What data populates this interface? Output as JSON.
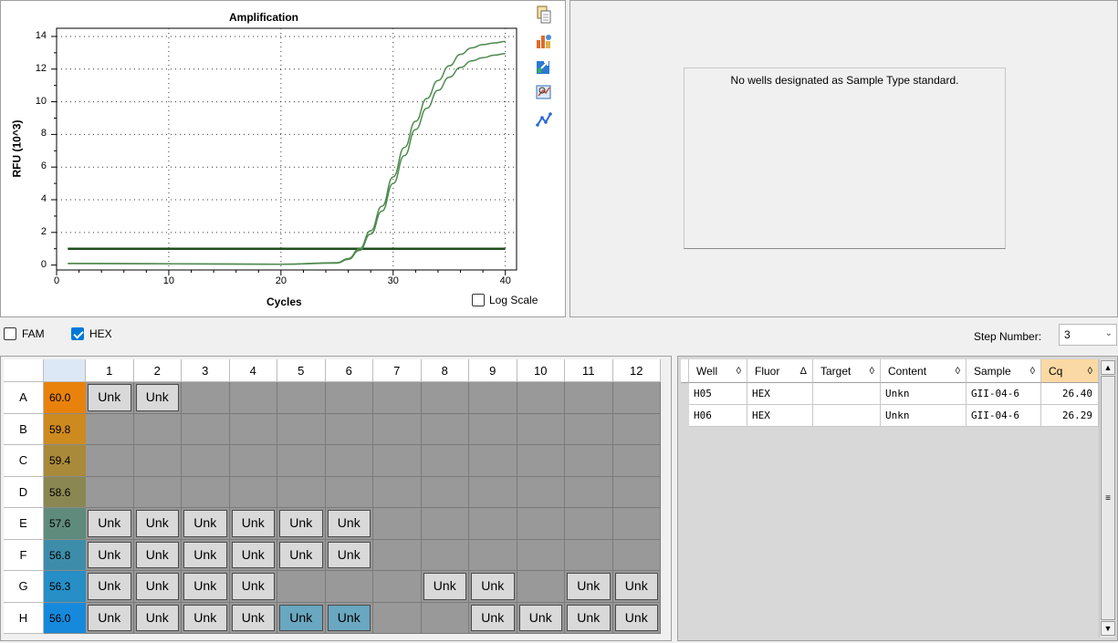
{
  "chart": {
    "title": "Amplification",
    "xlabel": "Cycles",
    "ylabel": "RFU (10^3)",
    "y_ticks": [
      "0",
      "2",
      "4",
      "6",
      "8",
      "10",
      "12",
      "14"
    ],
    "x_ticks": [
      "0",
      "10",
      "20",
      "30",
      "40"
    ],
    "log_scale_label": "Log Scale",
    "log_scale_checked": false,
    "tools": [
      "copy-icon",
      "chart-properties-icon",
      "export-icon",
      "zoom-icon",
      "trace-styles-icon"
    ]
  },
  "chart_data": {
    "type": "line",
    "title": "Amplification",
    "xlabel": "Cycles",
    "ylabel": "RFU (10^3)",
    "xlim": [
      0,
      41
    ],
    "ylim": [
      -0.3,
      14.5
    ],
    "grid": true,
    "threshold": 1.0,
    "series": [
      {
        "x": [
          1,
          20,
          25,
          26,
          27,
          28,
          29,
          30,
          31,
          32,
          33,
          34,
          35,
          36,
          37,
          38,
          39,
          40
        ],
        "y": [
          0.1,
          0.05,
          0.15,
          0.4,
          1.0,
          2.1,
          3.6,
          5.4,
          7.2,
          8.8,
          10.2,
          11.3,
          12.2,
          12.9,
          13.3,
          13.5,
          13.6,
          13.7
        ]
      },
      {
        "x": [
          1,
          20,
          25,
          26,
          27,
          28,
          29,
          30,
          31,
          32,
          33,
          34,
          35,
          36,
          37,
          38,
          39,
          40
        ],
        "y": [
          0.1,
          0.05,
          0.12,
          0.35,
          0.9,
          1.9,
          3.3,
          5.0,
          6.7,
          8.3,
          9.6,
          10.7,
          11.5,
          12.1,
          12.5,
          12.7,
          12.85,
          12.95
        ]
      }
    ]
  },
  "standard_curve": {
    "message": "No wells designated as Sample Type standard."
  },
  "fluors": [
    {
      "label": "FAM",
      "checked": false
    },
    {
      "label": "HEX",
      "checked": true
    }
  ],
  "step": {
    "label": "Step Number:",
    "value": "3"
  },
  "plate": {
    "columns": [
      "1",
      "2",
      "3",
      "4",
      "5",
      "6",
      "7",
      "8",
      "9",
      "10",
      "11",
      "12"
    ],
    "rows": [
      {
        "label": "A",
        "temp": "60.0",
        "temp_color": "#e8820c",
        "wells": [
          "Unk",
          "Unk",
          "",
          "",
          "",
          "",
          "",
          "",
          "",
          "",
          "",
          ""
        ]
      },
      {
        "label": "B",
        "temp": "59.8",
        "temp_color": "#cd8a1e",
        "wells": [
          "",
          "",
          "",
          "",
          "",
          "",
          "",
          "",
          "",
          "",
          "",
          ""
        ]
      },
      {
        "label": "C",
        "temp": "59.4",
        "temp_color": "#a98a3a",
        "wells": [
          "",
          "",
          "",
          "",
          "",
          "",
          "",
          "",
          "",
          "",
          "",
          ""
        ]
      },
      {
        "label": "D",
        "temp": "58.6",
        "temp_color": "#8a8752",
        "wells": [
          "",
          "",
          "",
          "",
          "",
          "",
          "",
          "",
          "",
          "",
          "",
          ""
        ]
      },
      {
        "label": "E",
        "temp": "57.6",
        "temp_color": "#5f8b7c",
        "wells": [
          "Unk",
          "Unk",
          "Unk",
          "Unk",
          "Unk",
          "Unk",
          "",
          "",
          "",
          "",
          "",
          ""
        ]
      },
      {
        "label": "F",
        "temp": "56.8",
        "temp_color": "#3d8daa",
        "wells": [
          "Unk",
          "Unk",
          "Unk",
          "Unk",
          "Unk",
          "Unk",
          "",
          "",
          "",
          "",
          "",
          ""
        ]
      },
      {
        "label": "G",
        "temp": "56.3",
        "temp_color": "#278ec6",
        "wells": [
          "Unk",
          "Unk",
          "Unk",
          "Unk",
          "",
          "",
          "",
          "Unk",
          "Unk",
          "",
          "Unk",
          "Unk"
        ]
      },
      {
        "label": "H",
        "temp": "56.0",
        "temp_color": "#1689dc",
        "wells": [
          "Unk",
          "Unk",
          "Unk",
          "Unk",
          "Unk",
          "Unk",
          "",
          "",
          "Unk",
          "Unk",
          "Unk",
          "Unk"
        ]
      }
    ],
    "selected": [
      "H5",
      "H6"
    ]
  },
  "results": {
    "headers": [
      {
        "label": "Well",
        "sort": "◊"
      },
      {
        "label": "Fluor",
        "sort": "Δ"
      },
      {
        "label": "Target",
        "sort": "◊"
      },
      {
        "label": "Content",
        "sort": "◊"
      },
      {
        "label": "Sample",
        "sort": "◊"
      },
      {
        "label": "Cq",
        "sort": "◊"
      }
    ],
    "rows": [
      [
        "H05",
        "HEX",
        "",
        "Unkn",
        "GII-04-6",
        "26.40"
      ],
      [
        "H06",
        "HEX",
        "",
        "Unkn",
        "GII-04-6",
        "26.29"
      ]
    ],
    "colors": {
      "cq_header_bg": "#fbd9a4"
    }
  }
}
